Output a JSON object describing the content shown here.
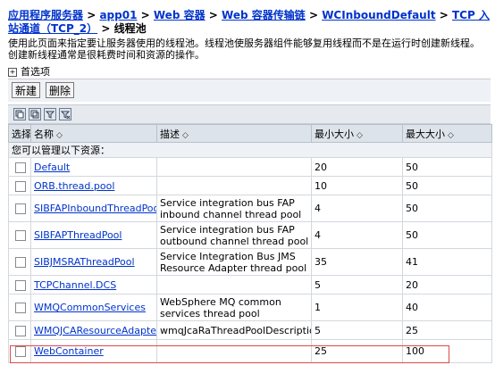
{
  "breadcrumb": {
    "items": [
      "应用程序服务器",
      "app01",
      "Web 容器",
      "Web 容器传输链",
      "WCInboundDefault",
      "TCP 入站通道（TCP_2）"
    ],
    "separator": ">",
    "current": "线程池"
  },
  "description": "使用此页面来指定要让服务器使用的线程池。线程池使服务器组件能够复用线程而不是在运行时创建新线程。创建新线程通常是很耗费时间和资源的操作。",
  "preferences": {
    "label": "首选项",
    "expand_symbol": "+"
  },
  "toolbar": {
    "new_label": "新建",
    "delete_label": "删除"
  },
  "icon_toolbar": [
    {
      "icon": "select-all-icon"
    },
    {
      "icon": "deselect-all-icon"
    },
    {
      "icon": "show-filter-icon"
    },
    {
      "icon": "clear-filter-icon"
    }
  ],
  "table": {
    "columns": [
      "选择",
      "名称",
      "描述",
      "最小大小",
      "最大大小"
    ],
    "sort_glyph": "◇",
    "group_label": "您可以管理以下资源：",
    "rows": [
      {
        "name": "Default",
        "description": "",
        "min": "20",
        "max": "50"
      },
      {
        "name": "ORB.thread.pool",
        "description": "",
        "min": "10",
        "max": "50"
      },
      {
        "name": "SIBFAPInboundThreadPool",
        "description": "Service integration bus FAP inbound channel thread pool",
        "min": "4",
        "max": "50"
      },
      {
        "name": "SIBFAPThreadPool",
        "description": "Service integration bus FAP outbound channel thread pool",
        "min": "4",
        "max": "50"
      },
      {
        "name": "SIBJMSRAThreadPool",
        "description": "Service Integration Bus JMS Resource Adapter thread pool",
        "min": "35",
        "max": "41"
      },
      {
        "name": "TCPChannel.DCS",
        "description": "",
        "min": "5",
        "max": "20"
      },
      {
        "name": "WMQCommonServices",
        "description": "WebSphere MQ common services thread pool",
        "min": "1",
        "max": "40"
      },
      {
        "name": "WMQJCAResourceAdapter",
        "description": "wmqJcaRaThreadPoolDescription",
        "min": "5",
        "max": "25"
      },
      {
        "name": "WebContainer",
        "description": "",
        "min": "25",
        "max": "100"
      }
    ]
  },
  "highlight_color": "#e04848",
  "link_color": "#0033cc"
}
